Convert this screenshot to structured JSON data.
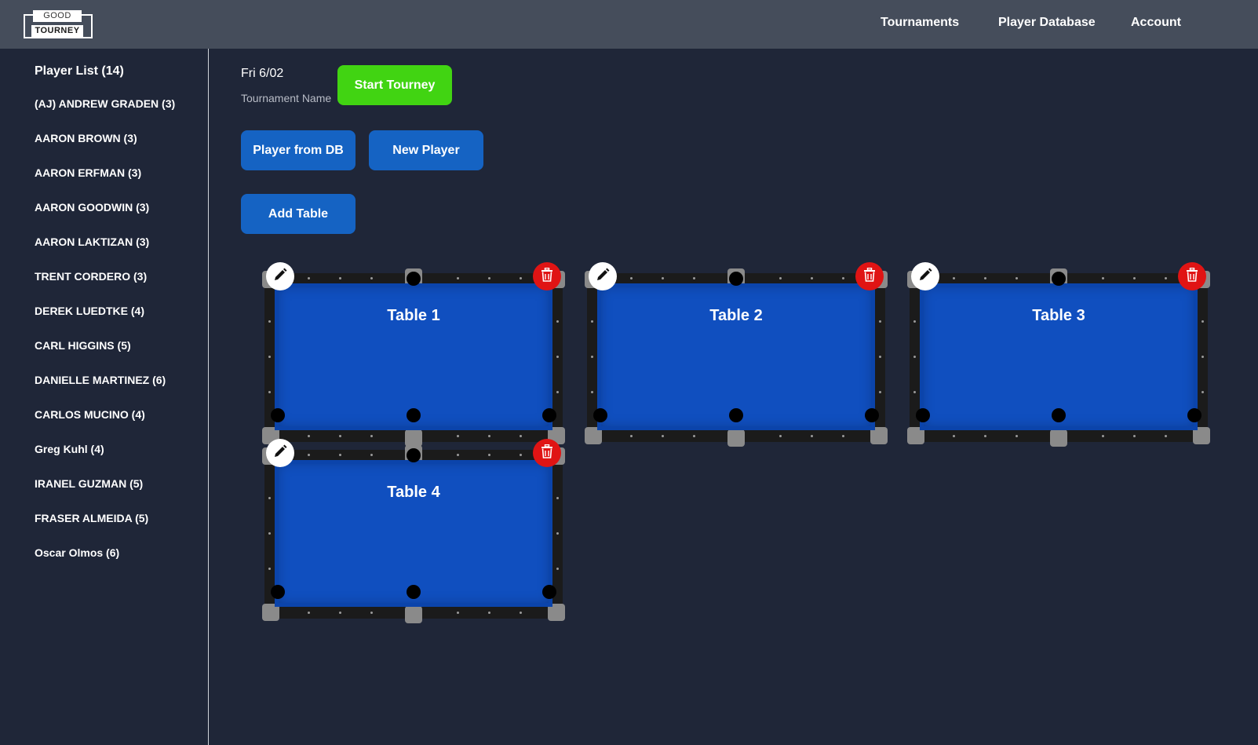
{
  "app": {
    "logo_top": "GOOD",
    "logo_bottom": "TOURNEY"
  },
  "nav": {
    "tournaments": "Tournaments",
    "player_database": "Player Database",
    "account": "Account"
  },
  "sidebar": {
    "title": "Player List (14)",
    "players": [
      "(AJ) ANDREW GRADEN (3)",
      "AARON BROWN (3)",
      "AARON ERFMAN (3)",
      "AARON GOODWIN (3)",
      "AARON LAKTIZAN (3)",
      "TRENT CORDERO (3)",
      "DEREK LUEDTKE (4)",
      "CARL HIGGINS (5)",
      "DANIELLE MARTINEZ (6)",
      "CARLOS MUCINO (4)",
      "Greg Kuhl (4)",
      "IRANEL GUZMAN (5)",
      "FRASER ALMEIDA (5)",
      "Oscar Olmos (6)"
    ]
  },
  "tournament": {
    "name": "Fri 6/02",
    "name_label": "Tournament Name"
  },
  "buttons": {
    "start": "Start Tourney",
    "player_from_db": "Player from DB",
    "new_player": "New Player",
    "add_table": "Add Table"
  },
  "tables": [
    {
      "title": "Table 1"
    },
    {
      "title": "Table 2"
    },
    {
      "title": "Table 3"
    },
    {
      "title": "Table 4"
    }
  ],
  "icons": {
    "edit": "pencil-icon",
    "delete": "trash-icon"
  },
  "colors": {
    "background": "#1f2638",
    "topbar": "#454d5b",
    "start_button": "#41d412",
    "primary_button": "#1563c3",
    "felt": "#104fbf",
    "delete": "#e01414"
  }
}
